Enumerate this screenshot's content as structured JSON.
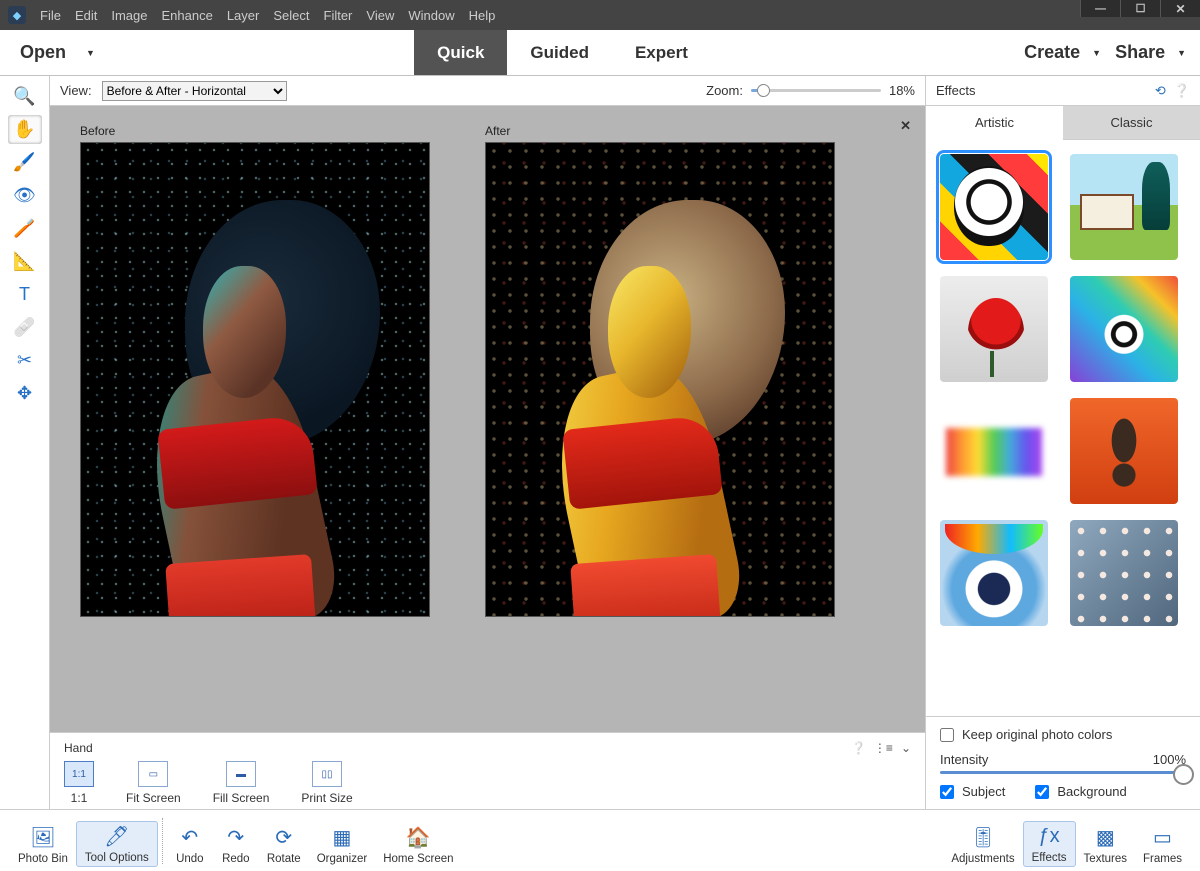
{
  "menu": {
    "items": [
      "File",
      "Edit",
      "Image",
      "Enhance",
      "Layer",
      "Select",
      "Filter",
      "View",
      "Window",
      "Help"
    ]
  },
  "modebar": {
    "open": "Open",
    "tabs": [
      {
        "label": "Quick",
        "active": true
      },
      {
        "label": "Guided",
        "active": false
      },
      {
        "label": "Expert",
        "active": false
      }
    ],
    "create": "Create",
    "share": "Share"
  },
  "tools": {
    "items": [
      {
        "name": "zoom-tool",
        "glyph": "🔍"
      },
      {
        "name": "hand-tool",
        "glyph": "✋",
        "selected": true
      },
      {
        "name": "quick-select-tool",
        "glyph": "🖌️"
      },
      {
        "name": "eye-tool",
        "glyph": "👁"
      },
      {
        "name": "whiten-tool",
        "glyph": "🪥"
      },
      {
        "name": "straighten-tool",
        "glyph": "📐"
      },
      {
        "name": "type-tool",
        "glyph": "T"
      },
      {
        "name": "spot-heal-tool",
        "glyph": "🩹"
      },
      {
        "name": "crop-tool",
        "glyph": "✂"
      },
      {
        "name": "move-tool",
        "glyph": "✥"
      }
    ]
  },
  "viewbar": {
    "view_label": "View:",
    "view_value": "Before & After - Horizontal",
    "zoom_label": "Zoom:",
    "zoom_value": "18%"
  },
  "canvas": {
    "before_label": "Before",
    "after_label": "After"
  },
  "hand_opts": {
    "title": "Hand",
    "buttons": [
      {
        "name": "one-to-one",
        "label": "1:1",
        "selected": true,
        "glyph": "1:1"
      },
      {
        "name": "fit-screen",
        "label": "Fit Screen",
        "glyph": "▭"
      },
      {
        "name": "fill-screen",
        "label": "Fill Screen",
        "glyph": "▬"
      },
      {
        "name": "print-size",
        "label": "Print Size",
        "glyph": "▯▯"
      }
    ]
  },
  "effects": {
    "title": "Effects",
    "tabs": [
      {
        "label": "Artistic",
        "active": true
      },
      {
        "label": "Classic",
        "active": false
      }
    ],
    "keep_colors_label": "Keep original photo colors",
    "keep_colors_checked": false,
    "intensity_label": "Intensity",
    "intensity_value": "100%",
    "subject_label": "Subject",
    "subject_checked": true,
    "background_label": "Background",
    "background_checked": true,
    "selected_index": 0,
    "presets": [
      "pop-art-cat",
      "landscape-houses",
      "red-poppy",
      "neon-animal",
      "color-splash",
      "the-scream",
      "makeup-eye",
      "cherry-blossom"
    ]
  },
  "cmdbar": {
    "left": [
      {
        "name": "photo-bin",
        "label": "Photo Bin",
        "glyph": "🖼"
      },
      {
        "name": "tool-options",
        "label": "Tool Options",
        "glyph": "🖊",
        "selected": true
      }
    ],
    "mid": [
      {
        "name": "undo",
        "label": "Undo",
        "glyph": "↶"
      },
      {
        "name": "redo",
        "label": "Redo",
        "glyph": "↷"
      },
      {
        "name": "rotate",
        "label": "Rotate",
        "glyph": "⟳"
      },
      {
        "name": "organizer",
        "label": "Organizer",
        "glyph": "▦"
      },
      {
        "name": "home-screen",
        "label": "Home Screen",
        "glyph": "🏠"
      }
    ],
    "right": [
      {
        "name": "adjustments",
        "label": "Adjustments",
        "glyph": "🎚"
      },
      {
        "name": "effects",
        "label": "Effects",
        "glyph": "ƒx",
        "selected": true
      },
      {
        "name": "textures",
        "label": "Textures",
        "glyph": "▩"
      },
      {
        "name": "frames",
        "label": "Frames",
        "glyph": "▭"
      }
    ]
  }
}
